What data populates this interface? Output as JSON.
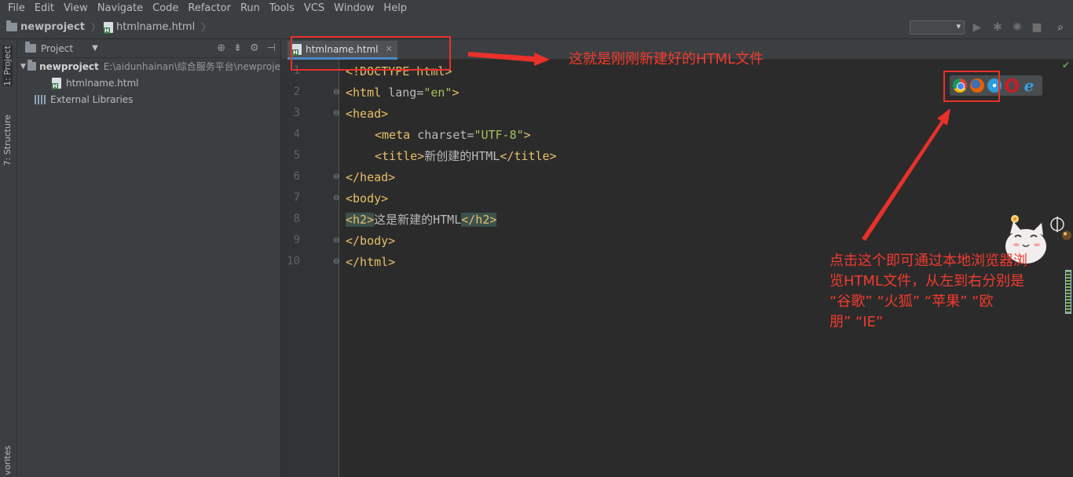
{
  "menu": [
    "File",
    "Edit",
    "View",
    "Navigate",
    "Code",
    "Refactor",
    "Run",
    "Tools",
    "VCS",
    "Window",
    "Help"
  ],
  "breadcrumb": {
    "project": "newproject",
    "file": "htmlname.html"
  },
  "left_strip": {
    "project_tab": "1: Project",
    "structure_tab": "7: Structure",
    "favorites_tab": "vorites"
  },
  "project_panel": {
    "header": "Project",
    "root_name": "newproject",
    "root_path": "E:\\aidunhainan\\综合服务平台\\newproje",
    "file_name": "htmlname.html",
    "external_libs": "External Libraries"
  },
  "editor": {
    "tab_label": "htmlname.html",
    "line_numbers": [
      "1",
      "2",
      "3",
      "4",
      "5",
      "6",
      "7",
      "8",
      "9",
      "10"
    ],
    "code": {
      "l1": "<!DOCTYPE html>",
      "l2_tag": "<html ",
      "l2_attr": "lang=",
      "l2_val": "\"en\"",
      "l2_end": ">",
      "l3": "<head>",
      "l4_tag": "<meta ",
      "l4_attr": "charset=",
      "l4_val": "\"UTF-8\"",
      "l4_end": ">",
      "l5_open": "<title>",
      "l5_text": "新创建的HTML",
      "l5_close": "</title>",
      "l6": "</head>",
      "l7": "<body>",
      "l8_open": "<h2>",
      "l8_text": "这是新建的HTML",
      "l8_close": "</h2>",
      "l9": "</body>",
      "l10": "</html>"
    }
  },
  "browsers": [
    "chrome-icon",
    "firefox-icon",
    "safari-icon",
    "opera-icon",
    "ie-icon"
  ],
  "annotations": {
    "top": "这就是刚刚新建好的HTML文件",
    "right_l1": "点击这个即可通过本地浏览器浏",
    "right_l2": "览HTML文件，从左到右分别是",
    "right_l3": "“谷歌”  “火狐”  “苹果”  “欧",
    "right_l4": "朋”  “IE”"
  },
  "colors": {
    "annotation_red": "#e8312a",
    "tag": "#e8bf6a",
    "value": "#a5c25c",
    "background": "#2b2b2b"
  }
}
